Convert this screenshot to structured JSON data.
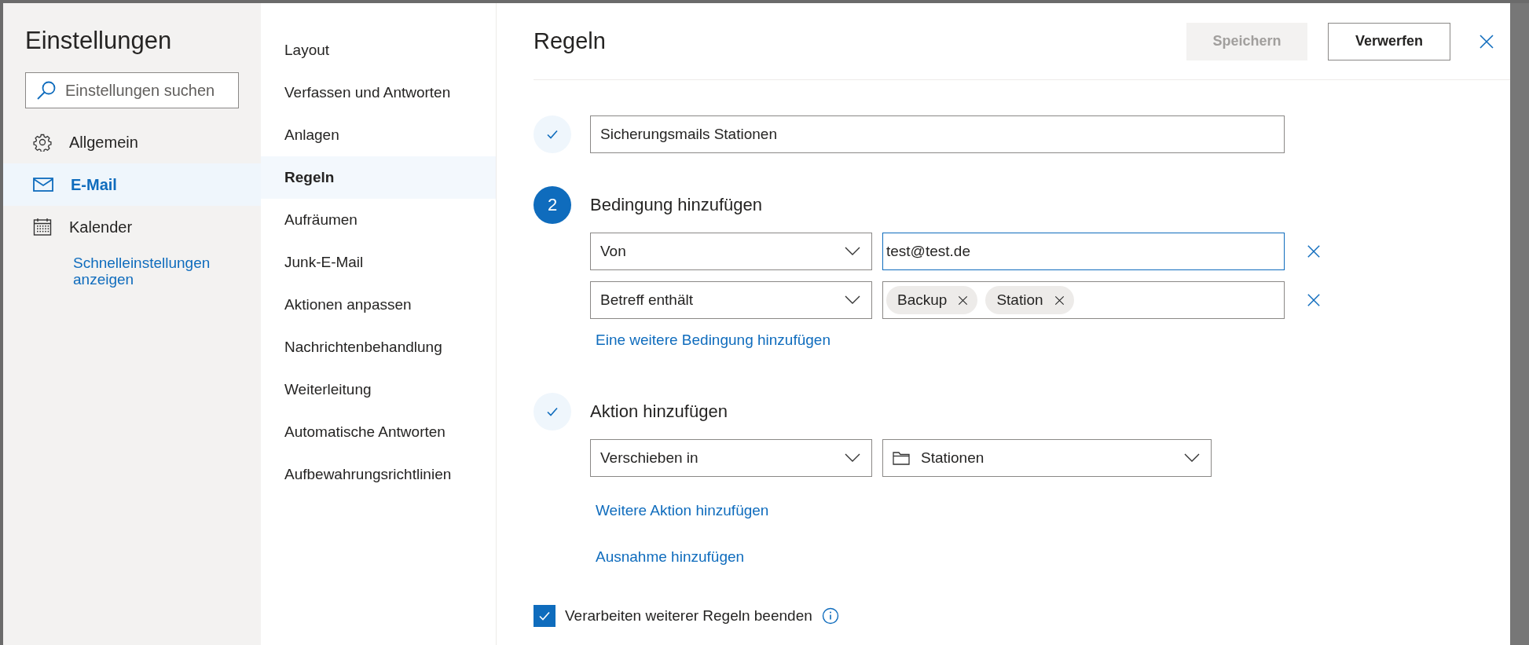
{
  "sidebar": {
    "title": "Einstellungen",
    "search": {
      "placeholder": "Einstellungen suchen"
    },
    "items": [
      {
        "label": "Allgemein",
        "kind": "gear",
        "selected": false
      },
      {
        "label": "E-Mail",
        "kind": "mail",
        "selected": true
      },
      {
        "label": "Kalender",
        "kind": "calendar",
        "selected": false
      }
    ],
    "link": "Schnelleinstellungen anzeigen"
  },
  "nav": {
    "items": [
      {
        "label": "Layout",
        "selected": false
      },
      {
        "label": "Verfassen und Antworten",
        "selected": false
      },
      {
        "label": "Anlagen",
        "selected": false
      },
      {
        "label": "Regeln",
        "selected": true
      },
      {
        "label": "Aufräumen",
        "selected": false
      },
      {
        "label": "Junk-E-Mail",
        "selected": false
      },
      {
        "label": "Aktionen anpassen",
        "selected": false
      },
      {
        "label": "Nachrichtenbehandlung",
        "selected": false
      },
      {
        "label": "Weiterleitung",
        "selected": false
      },
      {
        "label": "Automatische Antworten",
        "selected": false
      },
      {
        "label": "Aufbewahrungsrichtlinien",
        "selected": false
      }
    ]
  },
  "panel": {
    "title": "Regeln",
    "buttons": [
      {
        "label": "Speichern",
        "disabled": true
      },
      {
        "label": "Verwerfen",
        "disabled": false
      }
    ],
    "name_step": {
      "done": true,
      "value": "Sicherungsmails Stationen"
    },
    "condition_step": {
      "done": false,
      "number": "2",
      "title": "Bedingung hinzufügen",
      "rows": [
        {
          "field": "Von",
          "kind": "text",
          "value": "test@test.de",
          "focused": true
        },
        {
          "field": "Betreff enthält",
          "kind": "tags",
          "tags": [
            "Backup",
            "Station"
          ],
          "focused": false
        }
      ],
      "link": "Eine weitere Bedingung hinzufügen"
    },
    "action_step": {
      "done": true,
      "title": "Aktion hinzufügen",
      "action": "Verschieben in",
      "folder": "Stationen",
      "links": [
        "Weitere Aktion hinzufügen",
        "Ausnahme hinzufügen"
      ]
    },
    "stop_rules": {
      "label": "Verarbeiten weiterer Regeln beenden",
      "checked": true
    }
  }
}
